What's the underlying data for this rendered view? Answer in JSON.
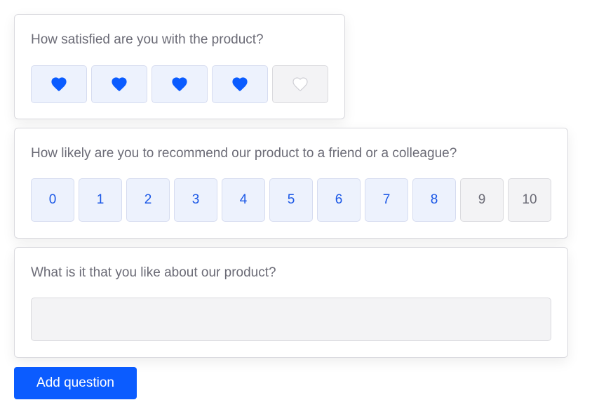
{
  "questions": {
    "satisfaction": {
      "title": "How satisfied are you with the product?",
      "rating": 4,
      "max": 5,
      "icon": "heart-icon",
      "active_color": "#0b5cff",
      "inactive_color": "#ffffff"
    },
    "recommend": {
      "title": "How likely are you to recommend our product to a friend or a colleague?",
      "options": [
        "0",
        "1",
        "2",
        "3",
        "4",
        "5",
        "6",
        "7",
        "8",
        "9",
        "10"
      ],
      "selected": "8"
    },
    "feedback": {
      "title": "What is it that you like about our product?",
      "value": "",
      "placeholder": ""
    }
  },
  "actions": {
    "add_question_label": "Add question"
  },
  "colors": {
    "accent": "#0b5cff",
    "active_bg": "#edf2fd",
    "inactive_bg": "#f3f3f5",
    "text_muted": "#6b6b76"
  }
}
